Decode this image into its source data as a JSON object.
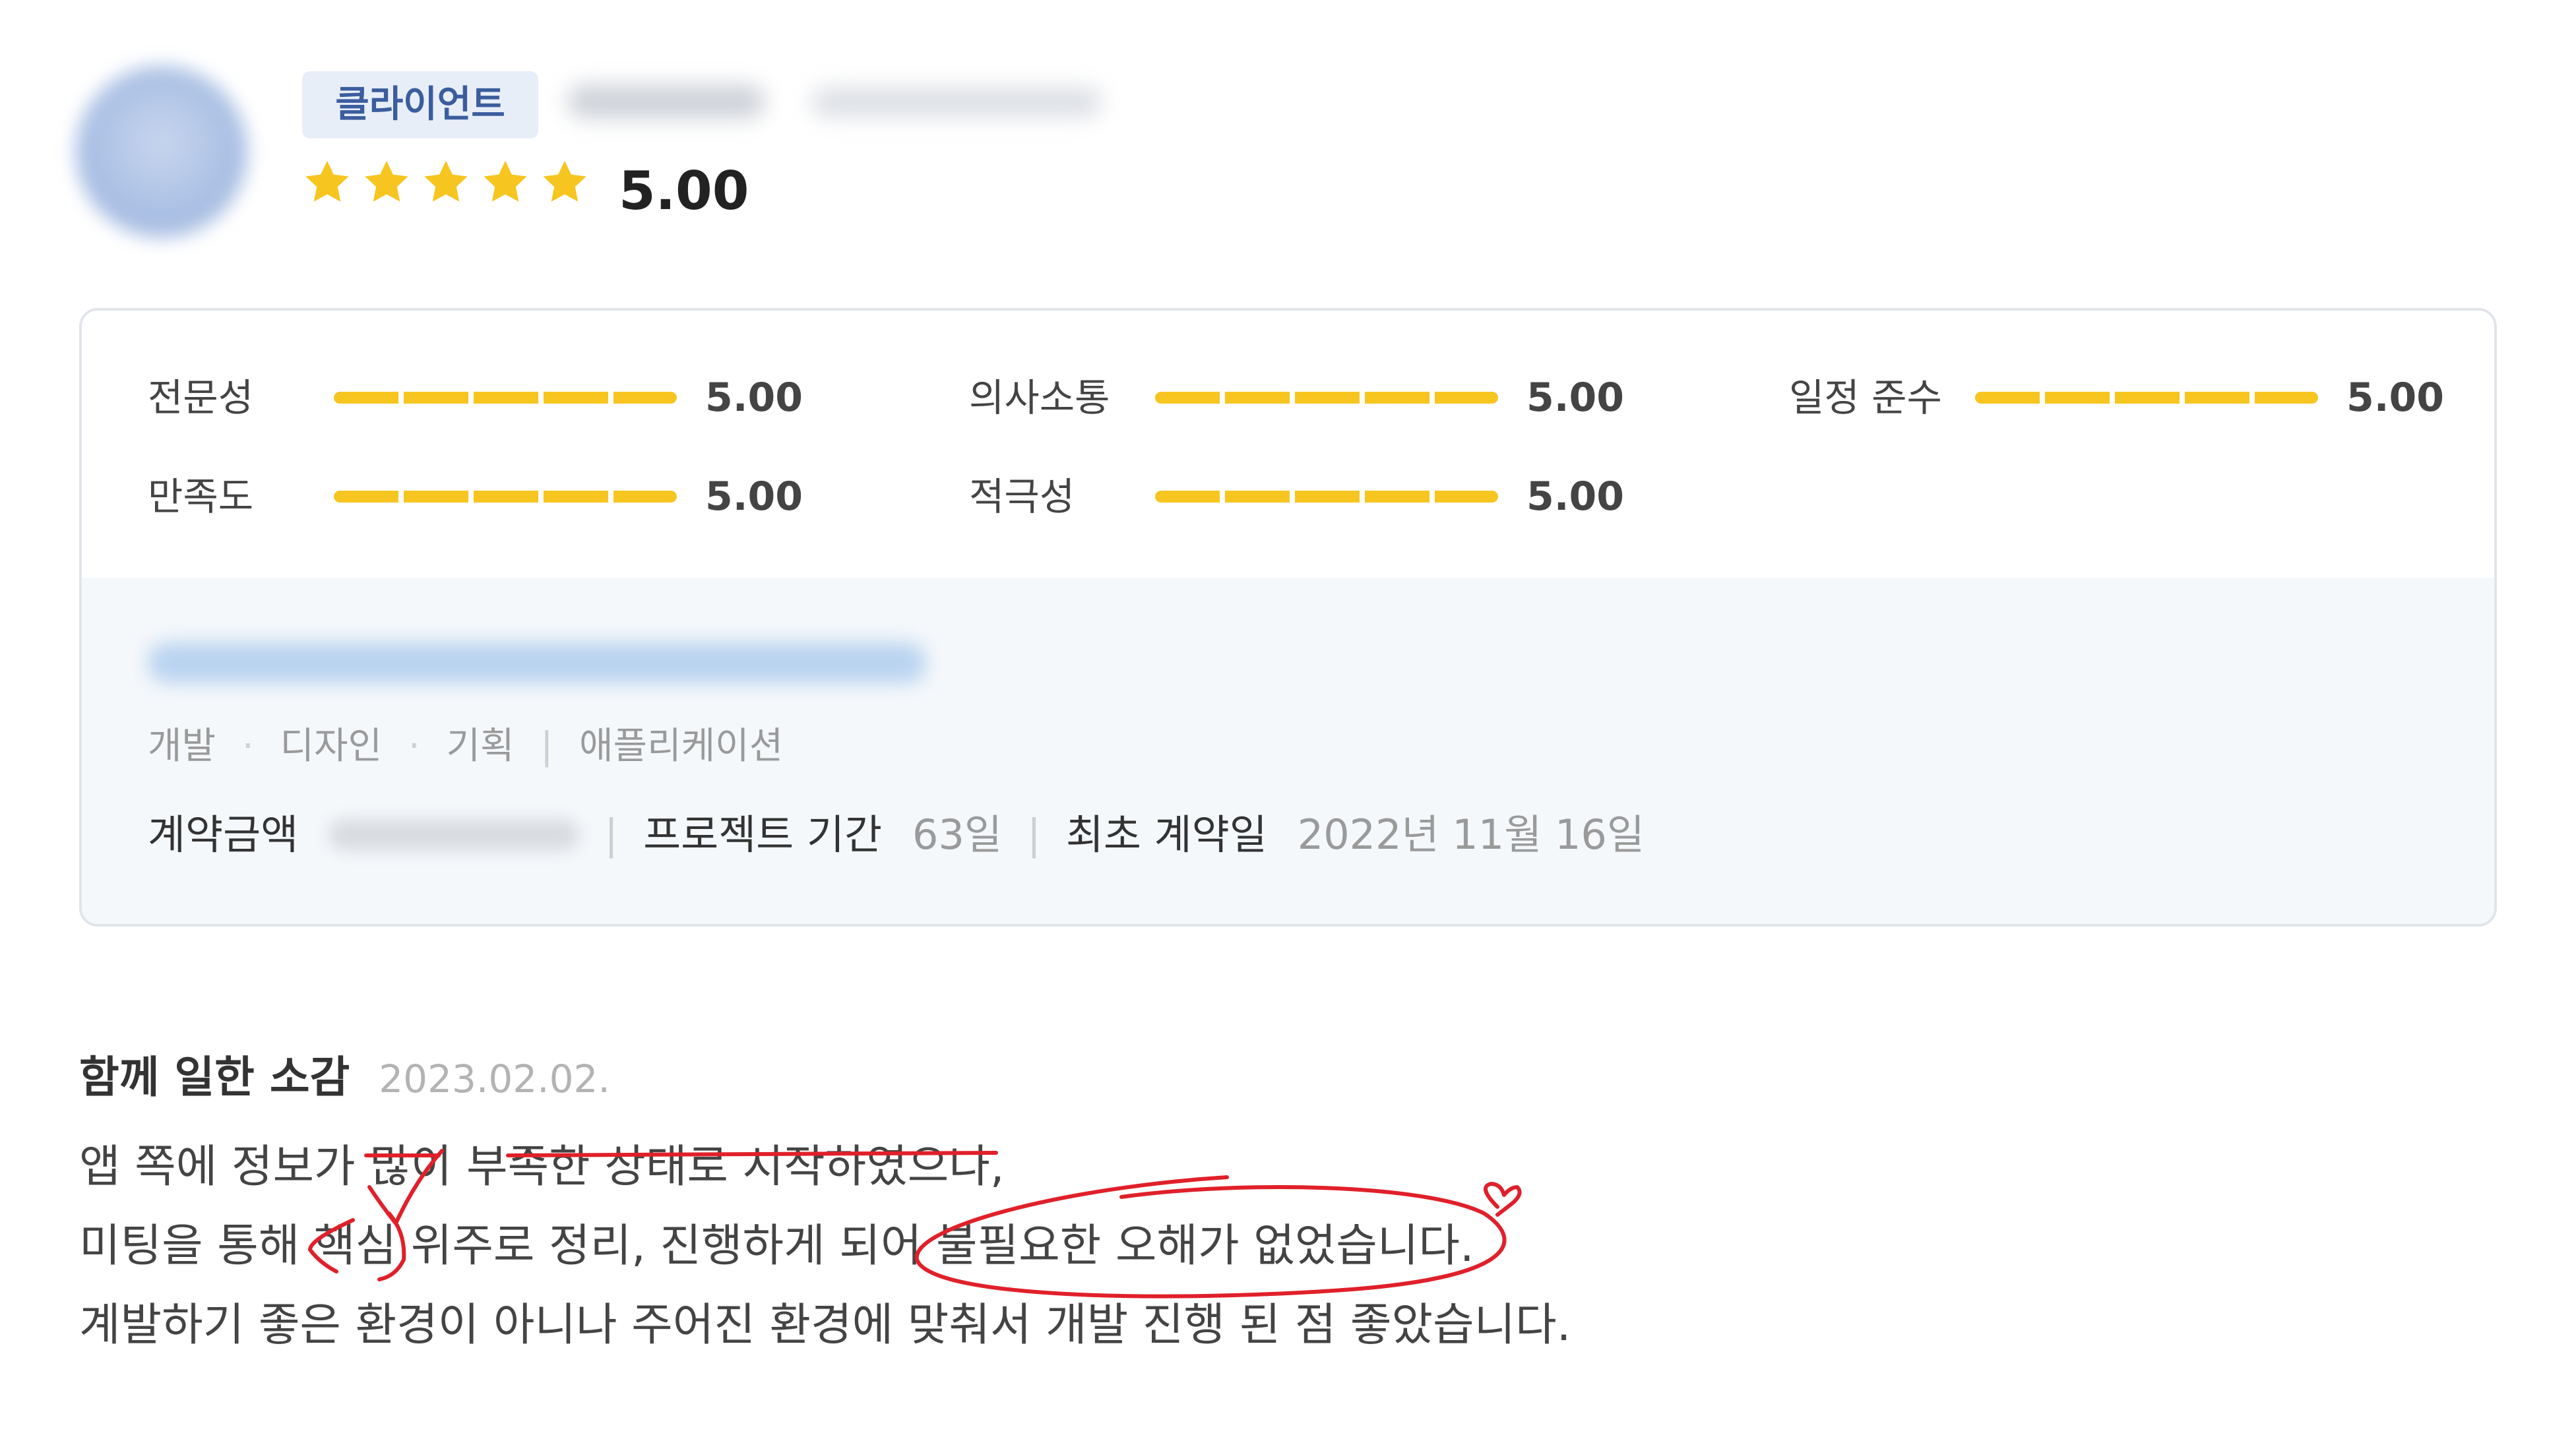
{
  "header": {
    "role_badge": "클라이언트",
    "rating_value": 5,
    "rating_max": 5,
    "overall_score": "5.00"
  },
  "metrics": [
    {
      "label": "전문성",
      "value": "5.00",
      "fill": 1.0
    },
    {
      "label": "의사소통",
      "value": "5.00",
      "fill": 1.0
    },
    {
      "label": "일정 준수",
      "value": "5.00",
      "fill": 1.0
    },
    {
      "label": "만족도",
      "value": "5.00",
      "fill": 1.0
    },
    {
      "label": "적극성",
      "value": "5.00",
      "fill": 1.0
    }
  ],
  "project": {
    "categories": [
      "개발",
      "디자인",
      "기획"
    ],
    "category_separator": "·",
    "platform": "애플리케이션",
    "contract_amount_label": "계약금액",
    "duration_label": "프로젝트 기간",
    "duration_value": "63일",
    "first_contract_label": "최초 계약일",
    "first_contract_value": "2022년 11월 16일"
  },
  "review": {
    "title": "함께 일한 소감",
    "date": "2023.02.02.",
    "lines": [
      "앱 쪽에 정보가 많이 부족한 상태로 시작하였으나,",
      "미팅을 통해 핵심 위주로 정리, 진행하게 되어 불필요한 오해가 없었습니다.",
      "계발하기 좋은 환경이 아니나 주어진 환경에 맞춰서 개발 진행 된 점 좋았습니다."
    ]
  },
  "colors": {
    "star": "#f7c520",
    "bar_fill": "#f7c520",
    "badge_bg": "#e8eef8",
    "badge_text": "#3b5d9e",
    "annotation": "#e0202a"
  },
  "icons": {
    "star": "star-icon"
  }
}
